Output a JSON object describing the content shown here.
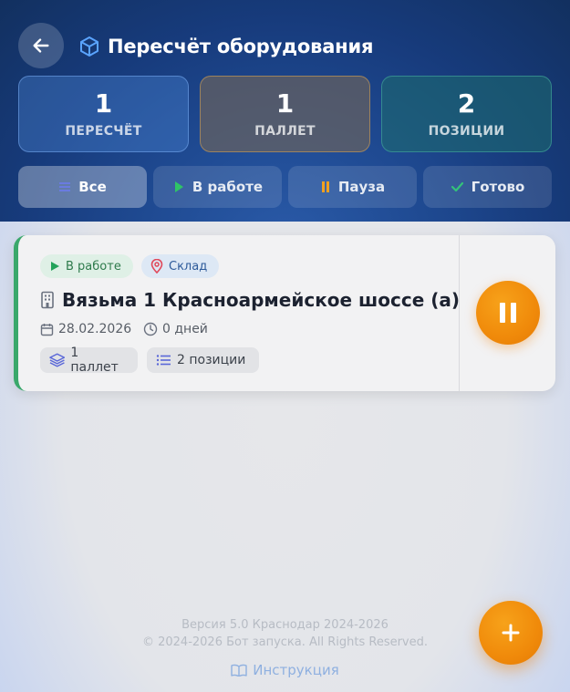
{
  "header": {
    "title": "Пересчёт оборудования",
    "back_icon": "arrow-left-icon",
    "title_icon": "cube-icon"
  },
  "stats": [
    {
      "value": "1",
      "label": "ПЕРЕСЧЁТ"
    },
    {
      "value": "1",
      "label": "ПАЛЛЕТ"
    },
    {
      "value": "2",
      "label": "ПОЗИЦИИ"
    }
  ],
  "filters": [
    {
      "label": "Все",
      "icon": "list-icon",
      "active": true
    },
    {
      "label": "В работе",
      "icon": "play-icon",
      "active": false
    },
    {
      "label": "Пауза",
      "icon": "pause-icon",
      "active": false
    },
    {
      "label": "Готово",
      "icon": "check-icon",
      "active": false
    }
  ],
  "card": {
    "status": "В работе",
    "place": "Склад",
    "title": "Вязьма 1 Красноармейское шоссе (а)",
    "date": "28.02.2026",
    "days": "0 дней",
    "pallets": "1 паллет",
    "positions": "2 позиции"
  },
  "footer": {
    "version": "Версия 5.0 Краснодар 2024-2026",
    "copyright": "© 2024-2026 Бот запуска. All Rights Reserved.",
    "instruction": "Инструкция"
  },
  "colors": {
    "accent_orange": "#f08a0a",
    "status_green": "#3aa86b",
    "header_blue": "#1f4a92"
  }
}
